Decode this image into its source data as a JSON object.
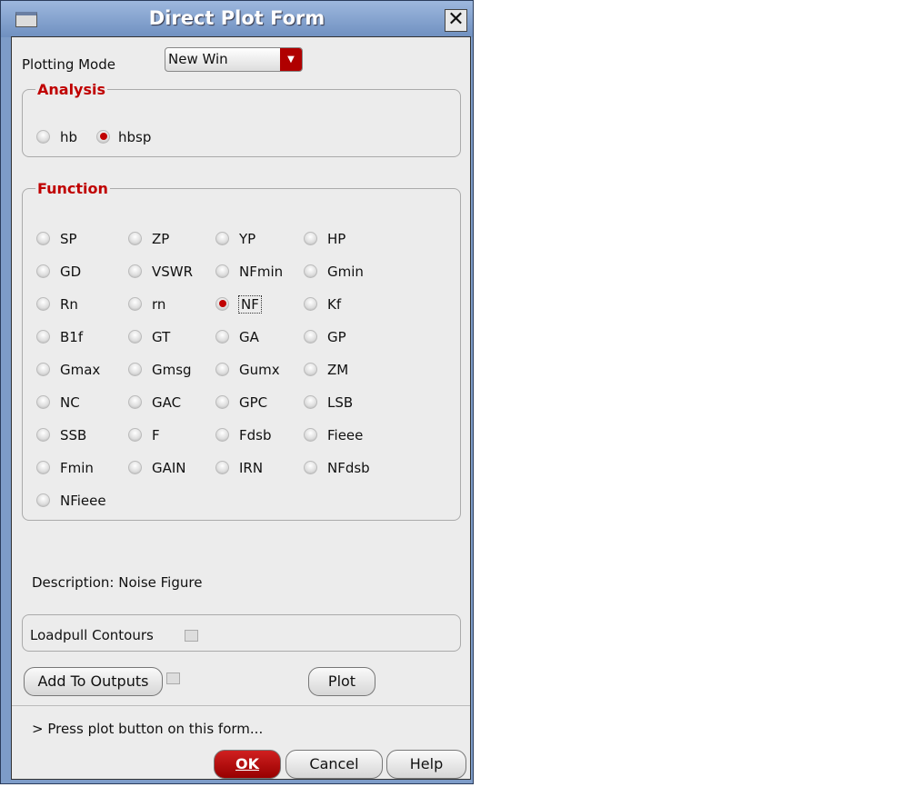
{
  "window": {
    "title": "Direct Plot Form"
  },
  "plotting_mode": {
    "label": "Plotting Mode",
    "value": "New Win"
  },
  "analysis": {
    "title": "Analysis",
    "options": [
      {
        "label": "hb",
        "selected": false
      },
      {
        "label": "hbsp",
        "selected": true
      }
    ]
  },
  "function": {
    "title": "Function",
    "options": [
      {
        "label": "SP"
      },
      {
        "label": "ZP"
      },
      {
        "label": "YP"
      },
      {
        "label": "HP"
      },
      {
        "label": "GD"
      },
      {
        "label": "VSWR"
      },
      {
        "label": "NFmin"
      },
      {
        "label": "Gmin"
      },
      {
        "label": "Rn"
      },
      {
        "label": "rn"
      },
      {
        "label": "NF",
        "selected": true
      },
      {
        "label": "Kf"
      },
      {
        "label": "B1f"
      },
      {
        "label": "GT"
      },
      {
        "label": "GA"
      },
      {
        "label": "GP"
      },
      {
        "label": "Gmax"
      },
      {
        "label": "Gmsg"
      },
      {
        "label": "Gumx"
      },
      {
        "label": "ZM"
      },
      {
        "label": "NC"
      },
      {
        "label": "GAC"
      },
      {
        "label": "GPC"
      },
      {
        "label": "LSB"
      },
      {
        "label": "SSB"
      },
      {
        "label": "F"
      },
      {
        "label": "Fdsb"
      },
      {
        "label": "Fieee"
      },
      {
        "label": "Fmin"
      },
      {
        "label": "GAIN"
      },
      {
        "label": "IRN"
      },
      {
        "label": "NFdsb"
      },
      {
        "label": "NFieee"
      }
    ]
  },
  "description": "Description: Noise Figure",
  "loadpull": {
    "label": "Loadpull Contours",
    "checked": false
  },
  "buttons": {
    "add_to_outputs": "Add To Outputs",
    "plot": "Plot",
    "ok": "OK",
    "cancel": "Cancel",
    "help": "Help"
  },
  "status": "> Press plot button on this form..."
}
